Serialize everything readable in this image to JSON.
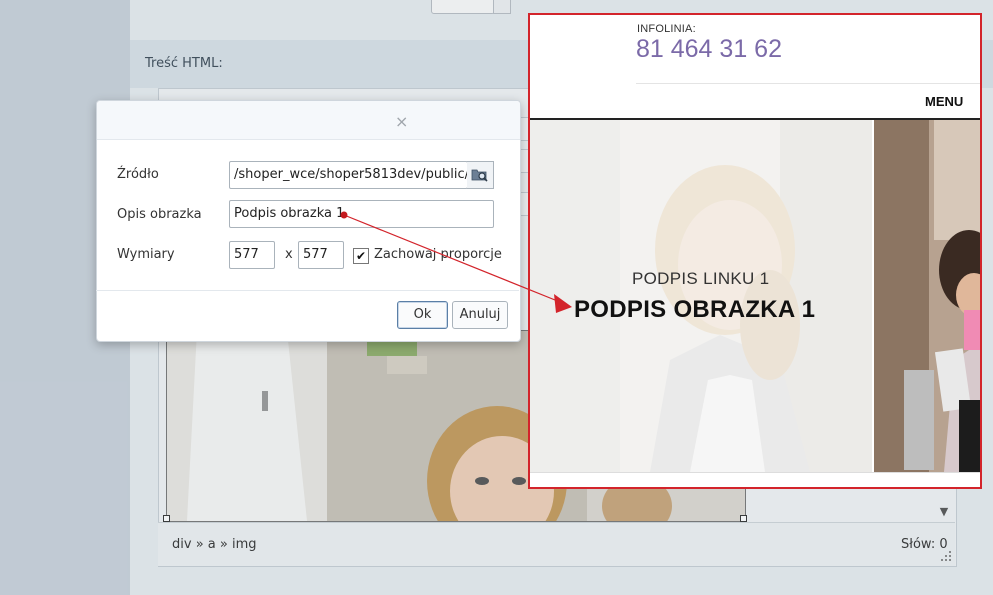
{
  "editor": {
    "html_label": "Treść HTML:",
    "path": "div » a » img",
    "word_count": "Słów: 0"
  },
  "dialog": {
    "close_symbol": "×",
    "source_label": "Źródło",
    "source_value": "/shoper_wce/shoper5813dev/public/",
    "alt_label": "Opis obrazka",
    "alt_value": "Podpis obrazka 1",
    "dimensions_label": "Wymiary",
    "width_value": "577",
    "separator": "x",
    "height_value": "577",
    "keep_ratio_label": "Zachowaj proporcje",
    "keep_ratio_checked": true,
    "ok_label": "Ok",
    "cancel_label": "Anuluj"
  },
  "preview": {
    "info_label": "INFOLINIA:",
    "phone": "81 464 31 62",
    "menu_label": "MENU",
    "caption_link": "PODPIS LINKU 1",
    "caption_title": "PODPIS OBRAZKA 1",
    "phone_color": "#7b6aa8",
    "border_color": "#d3242b"
  },
  "icons": {
    "browse": "folder-search-icon",
    "checkbox": "checkmark-icon",
    "scroll": "chevron-down-icon",
    "resize": "resize-grip-icon"
  }
}
